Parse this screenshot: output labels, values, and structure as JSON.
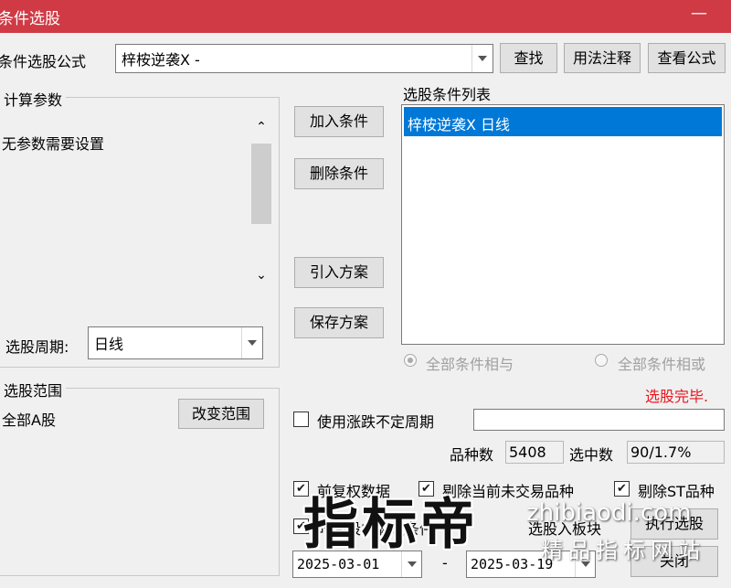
{
  "window": {
    "title": "条件选股",
    "minimize_glyph": "—"
  },
  "formula_row": {
    "label": "条件选股公式",
    "combo_value": "梓桉逆袭X  -",
    "buttons": {
      "find": "查找",
      "usage": "用法注释",
      "view_formula": "查看公式"
    }
  },
  "params": {
    "group_title": "计算参数",
    "text": "无参数需要设置",
    "period_label": "选股周期:",
    "period_value": "日线"
  },
  "actions": {
    "add": "加入条件",
    "delete": "删除条件",
    "import": "引入方案",
    "save": "保存方案"
  },
  "condition_list": {
    "title": "选股条件列表",
    "items": [
      "梓桉逆袭X  日线"
    ]
  },
  "logic": {
    "and_label": "全部条件相与",
    "or_label": "全部条件相或"
  },
  "status": {
    "text": "选股完毕.",
    "color": "#e8141e"
  },
  "range": {
    "group_title": "选股范围",
    "value": "全部A股",
    "change_button": "改变范围"
  },
  "options": {
    "use_period_label": "使用涨跌不定周期",
    "use_period_checked": false,
    "use_period_value": ""
  },
  "stats": {
    "count_label": "品种数",
    "count_value": "5408",
    "selected_label": "选中数",
    "selected_value": "90/1.7%"
  },
  "checks": {
    "fq_label": "前复权数据",
    "exclude_untraded_label": "剔除当前未交易品种",
    "exclude_st_label": "剔除ST品种",
    "range_label": "时间段内满足条件",
    "to_block_label": "选股入板块"
  },
  "buttons": {
    "run": "执行选股",
    "close": "关闭"
  },
  "dates": {
    "start": "2025-03-01",
    "separator": "-",
    "end": "2025-03-19"
  },
  "watermark": {
    "big": "指标帝",
    "url": "zhibiaodi.com",
    "sub": "精品指标网站"
  }
}
